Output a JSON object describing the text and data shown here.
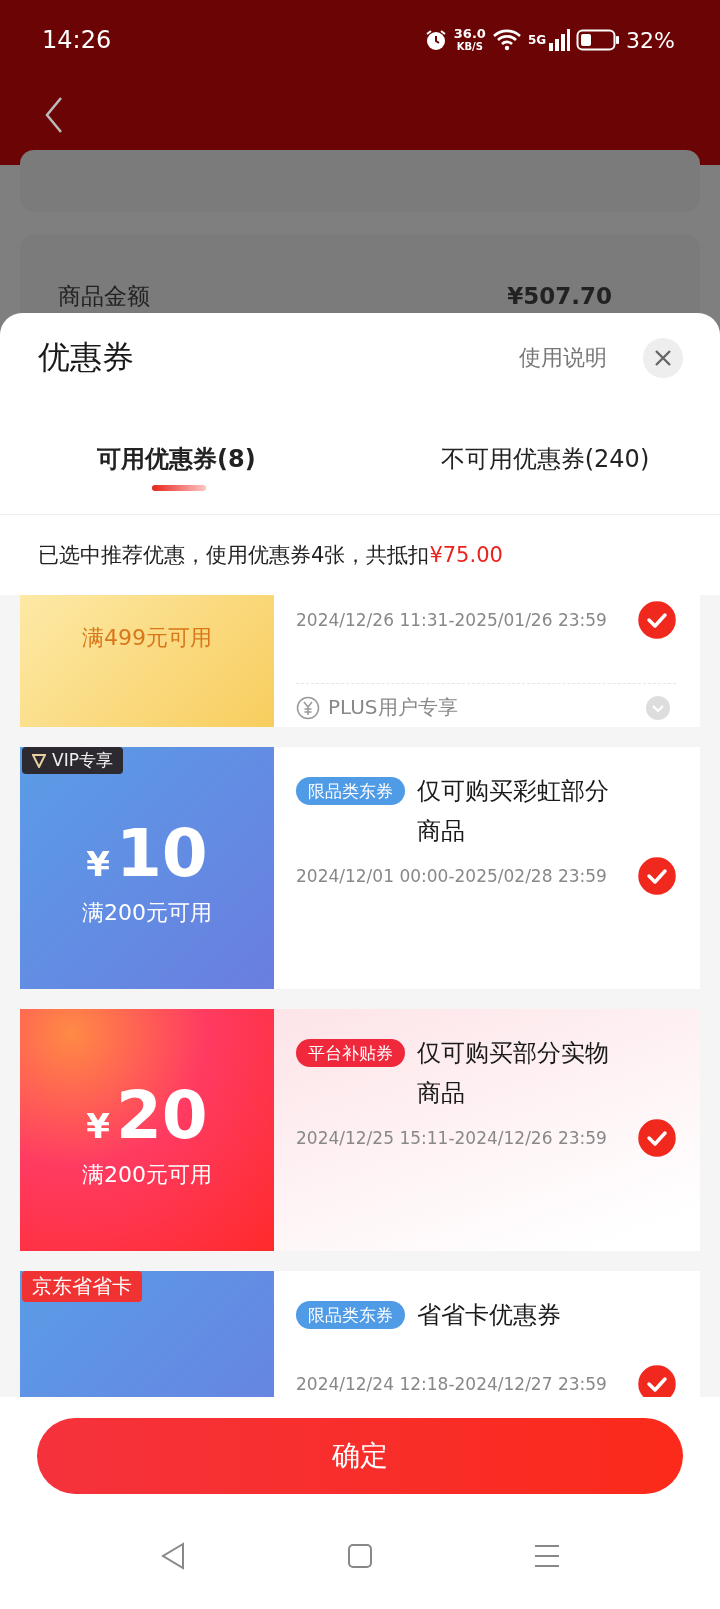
{
  "status_bar": {
    "time": "14:26",
    "speed": "36.0",
    "speed_unit": "KB/S",
    "network": "5G",
    "battery": "32%"
  },
  "background_page": {
    "label": "商品金额",
    "value": "¥507.70"
  },
  "sheet": {
    "title": "优惠券",
    "help_link": "使用说明"
  },
  "tabs": [
    {
      "label": "可用优惠券(8)",
      "selected": true
    },
    {
      "label": "不可用优惠券(240)",
      "selected": false
    }
  ],
  "summary": {
    "text": "已选中推荐优惠，使用优惠券4张，共抵扣",
    "amount": "¥75.00"
  },
  "coupons": [
    {
      "kind": "gold",
      "condition": "满499元可用",
      "date": "2024/12/26 11:31-2025/01/26 23:59",
      "checked": true,
      "note": "PLUS用户专享"
    },
    {
      "kind": "blue",
      "badge": {
        "kind": "vip",
        "text": "VIP专享"
      },
      "currency": "¥",
      "amount": "10",
      "condition": "满200元可用",
      "tag": {
        "text": "限品类东券",
        "color": "#4f9be6"
      },
      "title": "仅可购买彩虹部分商品",
      "date": "2024/12/01 00:00-2025/02/28 23:59",
      "checked": true
    },
    {
      "kind": "red",
      "currency": "¥",
      "amount": "20",
      "condition": "满200元可用",
      "tag": {
        "text": "平台补贴券",
        "color": "#f0283c"
      },
      "title": "仅可购买部分实物商品",
      "date": "2024/12/25 15:11-2024/12/26 23:59",
      "checked": true
    },
    {
      "kind": "blue",
      "badge": {
        "kind": "card",
        "text": "京东省省卡"
      },
      "tag": {
        "text": "限品类东券",
        "color": "#4f9be6"
      },
      "title": "省省卡优惠券",
      "date": "2024/12/24 12:18-2024/12/27 23:59",
      "checked": true
    }
  ],
  "confirm_button": "确定"
}
